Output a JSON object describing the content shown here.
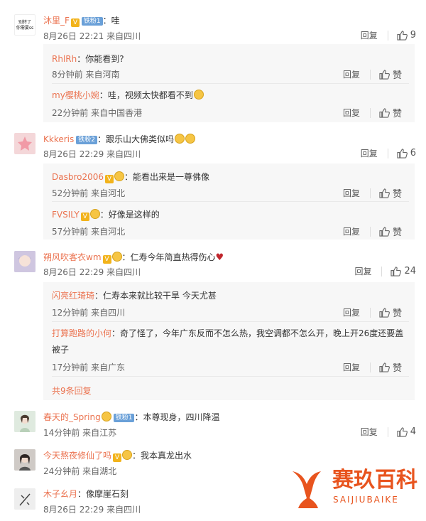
{
  "actions": {
    "reply": "回复",
    "like": "赞"
  },
  "comments": [
    {
      "user": "沐里_F",
      "badge": "铁粉1",
      "text": "哇",
      "time": "8月26日 22:21",
      "loc": "来自四川",
      "likes": "9",
      "avatar_text": [
        "别转了",
        "你需要ss"
      ],
      "replies": [
        {
          "user": "RhlRh",
          "text": "你能看到?",
          "time": "8分钟前",
          "loc": "来自河南"
        },
        {
          "user": "my樱桃小婉",
          "text": "哇，视频太快都看不到",
          "time": "22分钟前",
          "loc": "来自中国香港"
        }
      ]
    },
    {
      "user": "Kkkeris",
      "badge": "铁粉2",
      "text": "跟乐山大佛类似吗",
      "time": "8月26日 22:29",
      "loc": "来自四川",
      "likes": "6",
      "replies": [
        {
          "user": "Dasbro2006",
          "text": "能看出来是一尊佛像",
          "time": "52分钟前",
          "loc": "来自河北"
        },
        {
          "user": "FVSILY",
          "text": "好像是这样的",
          "time": "57分钟前",
          "loc": "来自河北"
        }
      ]
    },
    {
      "user": "朔风吹客衣wm",
      "text": "仁寿今年简直热得伤心",
      "time": "8月26日 22:29",
      "loc": "来自四川",
      "likes": "24",
      "replies": [
        {
          "user": "闪亮红琦琦",
          "text": "仁寿本来就比较干旱 今天尤甚",
          "time": "12分钟前",
          "loc": "来自四川"
        },
        {
          "user": "打算跑路的小何",
          "text": "奇了怪了，今年广东反而不怎么热，我空调都不怎么开，晚上开26度还要盖",
          "text2": "被子",
          "time": "17分钟前",
          "loc": "来自广东"
        }
      ],
      "more": "共9条回复"
    },
    {
      "user": "春天的_Spring",
      "badge": "铁粉1",
      "text": "本尊现身，四川降温",
      "time": "14分钟前",
      "loc": "来自江苏",
      "likes": "4"
    },
    {
      "user": "今天熬夜修仙了吗",
      "text": "我本真龙出水",
      "time": "24分钟前",
      "loc": "来自湖北"
    },
    {
      "user": "木子幺月",
      "text": "像摩崖石刻",
      "time": "8月26日 22:29",
      "loc": "来自四川"
    }
  ],
  "watermark": {
    "name": "赛玖百科",
    "latin": "SAIJIUBAIKE"
  },
  "colors": {
    "username": "#eb7350",
    "badge": "#6aa0d8",
    "vip": "#f2b31b",
    "reply_bg": "#f7f7f7"
  }
}
